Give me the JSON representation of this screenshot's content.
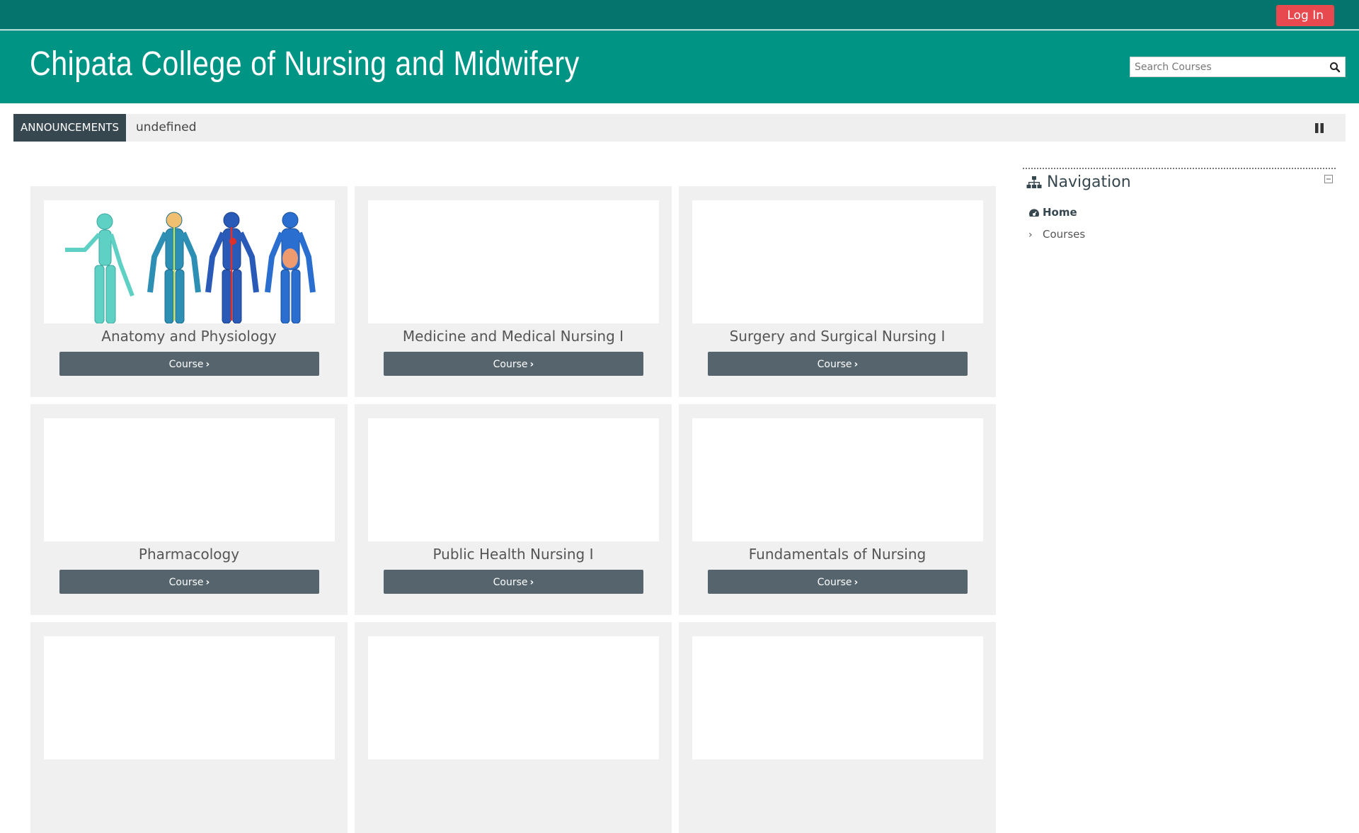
{
  "topbar": {
    "login_label": "Log In"
  },
  "header": {
    "title": "Chipata College of Nursing and Midwifery",
    "search_placeholder": "Search Courses"
  },
  "announcements": {
    "label": "ANNOUNCEMENTS",
    "text": "undefined"
  },
  "courses": [
    {
      "title": "Anatomy and Physiology",
      "button": "Course",
      "image": "human-body-systems"
    },
    {
      "title": "Medicine and Medical Nursing I",
      "button": "Course",
      "image": ""
    },
    {
      "title": "Surgery and Surgical Nursing I",
      "button": "Course",
      "image": ""
    },
    {
      "title": "Pharmacology",
      "button": "Course",
      "image": ""
    },
    {
      "title": "Public Health Nursing I",
      "button": "Course",
      "image": ""
    },
    {
      "title": "Fundamentals of Nursing",
      "button": "Course",
      "image": ""
    },
    {
      "title": "",
      "button": "",
      "image": ""
    },
    {
      "title": "",
      "button": "",
      "image": ""
    },
    {
      "title": "",
      "button": "",
      "image": ""
    }
  ],
  "navigation": {
    "title": "Navigation",
    "items": [
      {
        "label": "Home",
        "icon": "dashboard-icon"
      },
      {
        "label": "Courses",
        "icon": "chevron-right-icon"
      }
    ]
  },
  "colors": {
    "topbar": "#05746c",
    "header": "#009485",
    "login": "#e8494f",
    "button": "#55646d",
    "announce_label": "#37474f"
  }
}
